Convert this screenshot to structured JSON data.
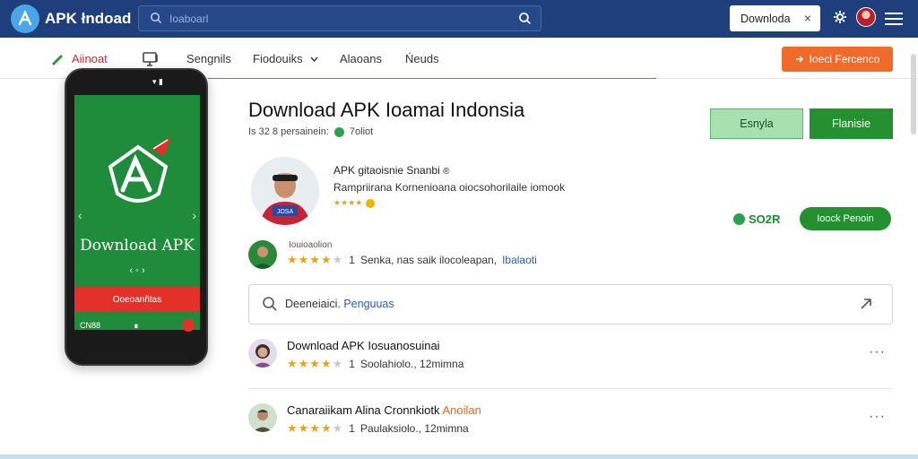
{
  "header": {
    "app_title": "APK łndoad",
    "search_placeholder": "Ioaboarl",
    "download_button": "Downloda",
    "close_symbol": "×"
  },
  "nav": {
    "items": [
      {
        "label": "Aiinoat"
      },
      {
        "label": "Sengnils"
      },
      {
        "label": "Fiodouiks"
      },
      {
        "label": "Alaoans"
      },
      {
        "label": "Ńeuds"
      }
    ],
    "action_button": "Ioeci Fercenco"
  },
  "phone": {
    "title": "Download APK",
    "dots": "‹ ◦ ›",
    "download_label": "Ooeoanñtas",
    "bottom_left": "CN88",
    "bottom_mid": "∎"
  },
  "app": {
    "title": "Download APK Ioamai Indonsia",
    "meta": "Is 32 8 persainein:",
    "meta_tag": "7oliot",
    "button_light": "Esnyla",
    "button_dark": "Flanisie"
  },
  "developer": {
    "name": "APK gitaoisnie Snanbi",
    "desc": "Rampriirana Kornenioana oiocsohorilaile iomook",
    "price": "SO2R",
    "price_button": "Ioock Penoin",
    "avatar_text": "JOSA"
  },
  "review1": {
    "label": "Iouioaolion",
    "count": "1",
    "text": "Senka, nas saik ilocoleapan,",
    "link": "Ibalaoti"
  },
  "search2": {
    "text": "Deeneiaici.",
    "link": "Penguuas"
  },
  "list": [
    {
      "title": "Download APK Iosuanosuinai",
      "count": "1",
      "rating_text": "Soolahiolo., 12mimna",
      "highlight": ""
    },
    {
      "title": "Canaraiikam Alina Cronnkiotk",
      "highlight": "Anoilan",
      "count": "1",
      "rating_text": "Paulaksiolo., 12mimna"
    }
  ],
  "colors": {
    "topbar": "#1f3f7c",
    "accent_green": "#24902f",
    "accent_orange": "#f06a2a",
    "phone_screen": "#1e8c3a"
  }
}
